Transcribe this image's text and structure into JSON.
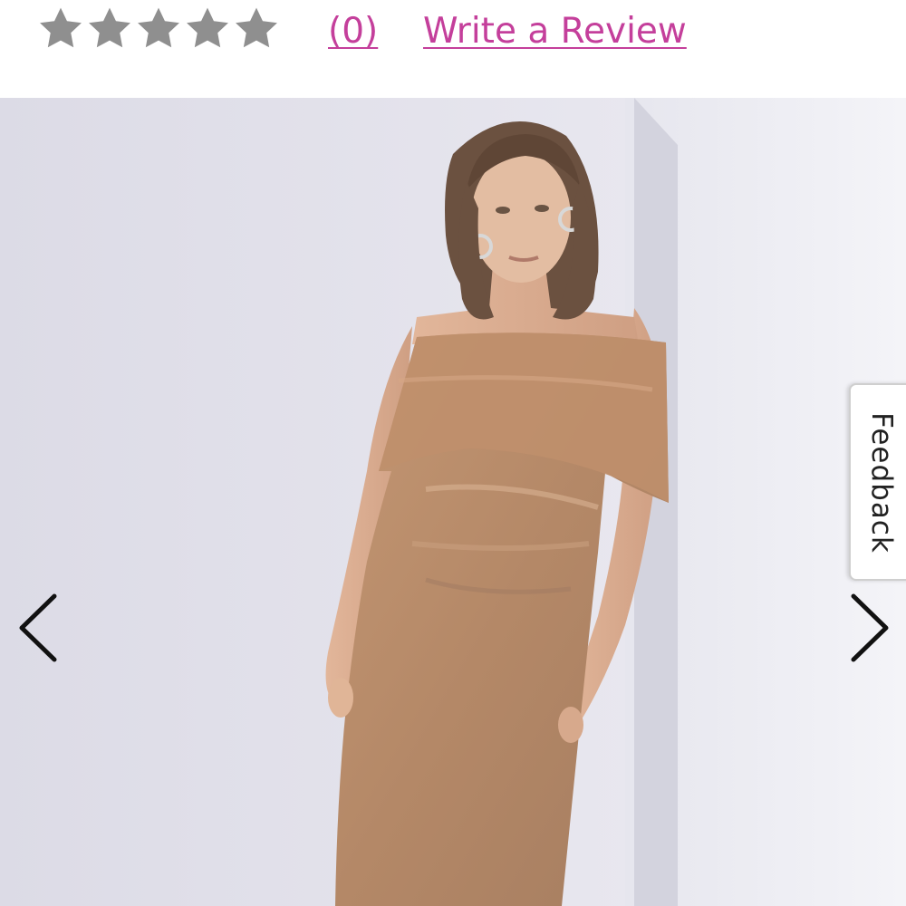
{
  "rating": {
    "stars_total": 5,
    "stars_filled": 0,
    "review_count": "(0)",
    "write_review_label": "Write a Review"
  },
  "gallery": {
    "image_alt": "Model wearing off-shoulder metallic rose-gold midi dress",
    "prev_icon": "chevron-left-icon",
    "next_icon": "chevron-right-icon"
  },
  "feedback": {
    "label": "Feedback"
  },
  "colors": {
    "accent": "#c43f9b",
    "star_empty": "#8f8f8f",
    "dress": "#b88a6a"
  }
}
